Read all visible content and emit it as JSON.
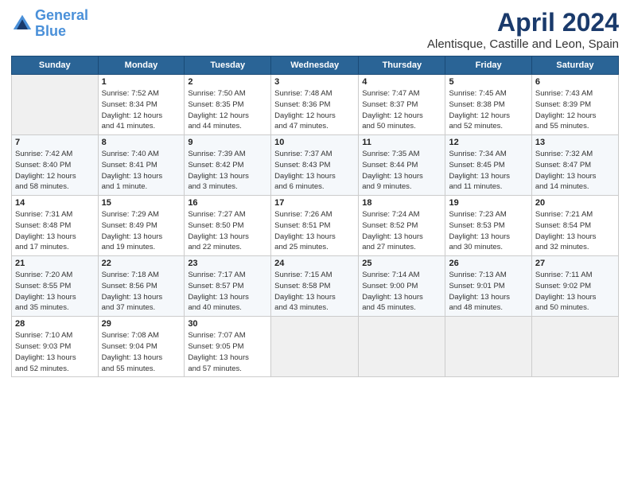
{
  "header": {
    "logo_line1": "General",
    "logo_line2": "Blue",
    "main_title": "April 2024",
    "subtitle": "Alentisque, Castille and Leon, Spain"
  },
  "days_of_week": [
    "Sunday",
    "Monday",
    "Tuesday",
    "Wednesday",
    "Thursday",
    "Friday",
    "Saturday"
  ],
  "weeks": [
    [
      {
        "day": "",
        "info": ""
      },
      {
        "day": "1",
        "info": "Sunrise: 7:52 AM\nSunset: 8:34 PM\nDaylight: 12 hours\nand 41 minutes."
      },
      {
        "day": "2",
        "info": "Sunrise: 7:50 AM\nSunset: 8:35 PM\nDaylight: 12 hours\nand 44 minutes."
      },
      {
        "day": "3",
        "info": "Sunrise: 7:48 AM\nSunset: 8:36 PM\nDaylight: 12 hours\nand 47 minutes."
      },
      {
        "day": "4",
        "info": "Sunrise: 7:47 AM\nSunset: 8:37 PM\nDaylight: 12 hours\nand 50 minutes."
      },
      {
        "day": "5",
        "info": "Sunrise: 7:45 AM\nSunset: 8:38 PM\nDaylight: 12 hours\nand 52 minutes."
      },
      {
        "day": "6",
        "info": "Sunrise: 7:43 AM\nSunset: 8:39 PM\nDaylight: 12 hours\nand 55 minutes."
      }
    ],
    [
      {
        "day": "7",
        "info": "Sunrise: 7:42 AM\nSunset: 8:40 PM\nDaylight: 12 hours\nand 58 minutes."
      },
      {
        "day": "8",
        "info": "Sunrise: 7:40 AM\nSunset: 8:41 PM\nDaylight: 13 hours\nand 1 minute."
      },
      {
        "day": "9",
        "info": "Sunrise: 7:39 AM\nSunset: 8:42 PM\nDaylight: 13 hours\nand 3 minutes."
      },
      {
        "day": "10",
        "info": "Sunrise: 7:37 AM\nSunset: 8:43 PM\nDaylight: 13 hours\nand 6 minutes."
      },
      {
        "day": "11",
        "info": "Sunrise: 7:35 AM\nSunset: 8:44 PM\nDaylight: 13 hours\nand 9 minutes."
      },
      {
        "day": "12",
        "info": "Sunrise: 7:34 AM\nSunset: 8:45 PM\nDaylight: 13 hours\nand 11 minutes."
      },
      {
        "day": "13",
        "info": "Sunrise: 7:32 AM\nSunset: 8:47 PM\nDaylight: 13 hours\nand 14 minutes."
      }
    ],
    [
      {
        "day": "14",
        "info": "Sunrise: 7:31 AM\nSunset: 8:48 PM\nDaylight: 13 hours\nand 17 minutes."
      },
      {
        "day": "15",
        "info": "Sunrise: 7:29 AM\nSunset: 8:49 PM\nDaylight: 13 hours\nand 19 minutes."
      },
      {
        "day": "16",
        "info": "Sunrise: 7:27 AM\nSunset: 8:50 PM\nDaylight: 13 hours\nand 22 minutes."
      },
      {
        "day": "17",
        "info": "Sunrise: 7:26 AM\nSunset: 8:51 PM\nDaylight: 13 hours\nand 25 minutes."
      },
      {
        "day": "18",
        "info": "Sunrise: 7:24 AM\nSunset: 8:52 PM\nDaylight: 13 hours\nand 27 minutes."
      },
      {
        "day": "19",
        "info": "Sunrise: 7:23 AM\nSunset: 8:53 PM\nDaylight: 13 hours\nand 30 minutes."
      },
      {
        "day": "20",
        "info": "Sunrise: 7:21 AM\nSunset: 8:54 PM\nDaylight: 13 hours\nand 32 minutes."
      }
    ],
    [
      {
        "day": "21",
        "info": "Sunrise: 7:20 AM\nSunset: 8:55 PM\nDaylight: 13 hours\nand 35 minutes."
      },
      {
        "day": "22",
        "info": "Sunrise: 7:18 AM\nSunset: 8:56 PM\nDaylight: 13 hours\nand 37 minutes."
      },
      {
        "day": "23",
        "info": "Sunrise: 7:17 AM\nSunset: 8:57 PM\nDaylight: 13 hours\nand 40 minutes."
      },
      {
        "day": "24",
        "info": "Sunrise: 7:15 AM\nSunset: 8:58 PM\nDaylight: 13 hours\nand 43 minutes."
      },
      {
        "day": "25",
        "info": "Sunrise: 7:14 AM\nSunset: 9:00 PM\nDaylight: 13 hours\nand 45 minutes."
      },
      {
        "day": "26",
        "info": "Sunrise: 7:13 AM\nSunset: 9:01 PM\nDaylight: 13 hours\nand 48 minutes."
      },
      {
        "day": "27",
        "info": "Sunrise: 7:11 AM\nSunset: 9:02 PM\nDaylight: 13 hours\nand 50 minutes."
      }
    ],
    [
      {
        "day": "28",
        "info": "Sunrise: 7:10 AM\nSunset: 9:03 PM\nDaylight: 13 hours\nand 52 minutes."
      },
      {
        "day": "29",
        "info": "Sunrise: 7:08 AM\nSunset: 9:04 PM\nDaylight: 13 hours\nand 55 minutes."
      },
      {
        "day": "30",
        "info": "Sunrise: 7:07 AM\nSunset: 9:05 PM\nDaylight: 13 hours\nand 57 minutes."
      },
      {
        "day": "",
        "info": ""
      },
      {
        "day": "",
        "info": ""
      },
      {
        "day": "",
        "info": ""
      },
      {
        "day": "",
        "info": ""
      }
    ]
  ]
}
